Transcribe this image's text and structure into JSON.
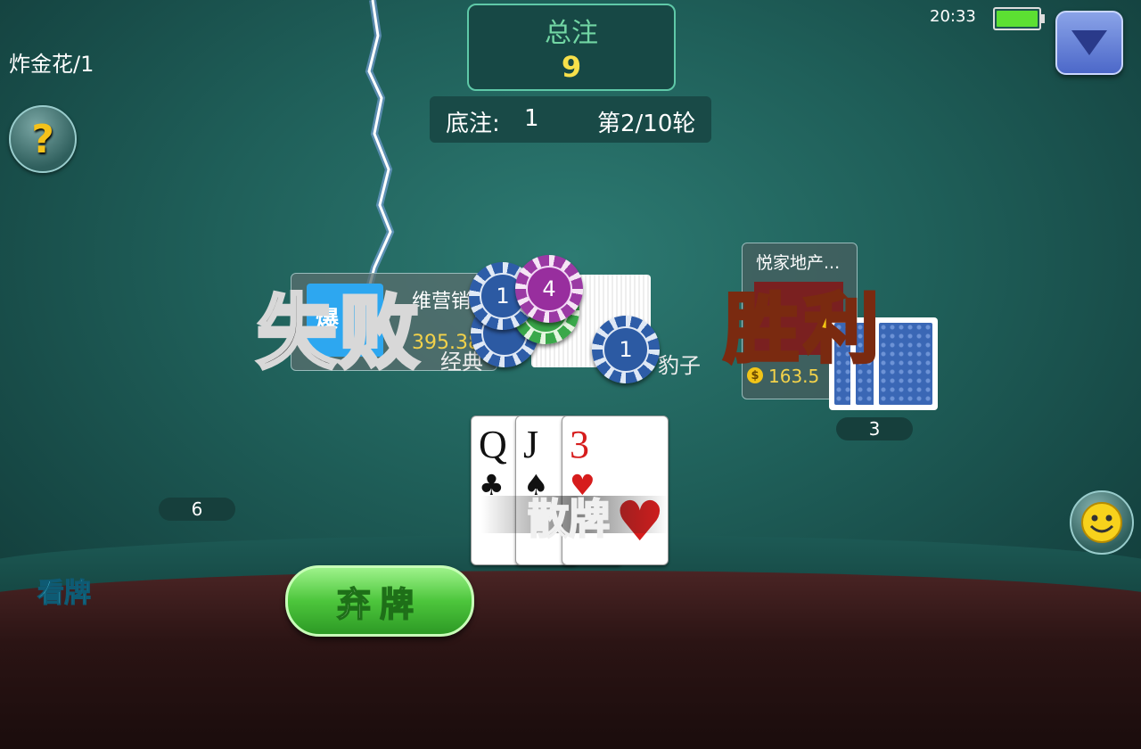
{
  "game": {
    "title": "炸金花/1"
  },
  "pot": {
    "label": "总注",
    "value": "9"
  },
  "round_info": {
    "base_label": "底注:",
    "base_value": "1",
    "round_text": "第2/10轮"
  },
  "status_bar": {
    "time": "20:33",
    "battery": 1.0
  },
  "left_player": {
    "avatar_text": "爆",
    "name": "维营销",
    "score": "395.38",
    "hand_label": "经典",
    "result": "失败"
  },
  "right_player": {
    "name": "悦家地产...",
    "score": "163.5",
    "result": "胜利",
    "card_count": "3",
    "hand_type": "豹子"
  },
  "chips": [
    "1",
    "4",
    "1"
  ],
  "my_hand": {
    "cards": [
      {
        "rank": "Q",
        "suit": "♣"
      },
      {
        "rank": "J",
        "suit": "♠"
      },
      {
        "rank": "3",
        "suit": "♥"
      }
    ],
    "hand_type": "散牌"
  },
  "my_card_count": "6",
  "actions": {
    "look": "看牌",
    "fold": "弃牌"
  },
  "colors": {
    "felt": "#1f5f59",
    "gold": "#f7e04a",
    "green_button": "#4dc63c",
    "chip_blue": "#2c5aa3",
    "chip_purple": "#982e9e"
  }
}
